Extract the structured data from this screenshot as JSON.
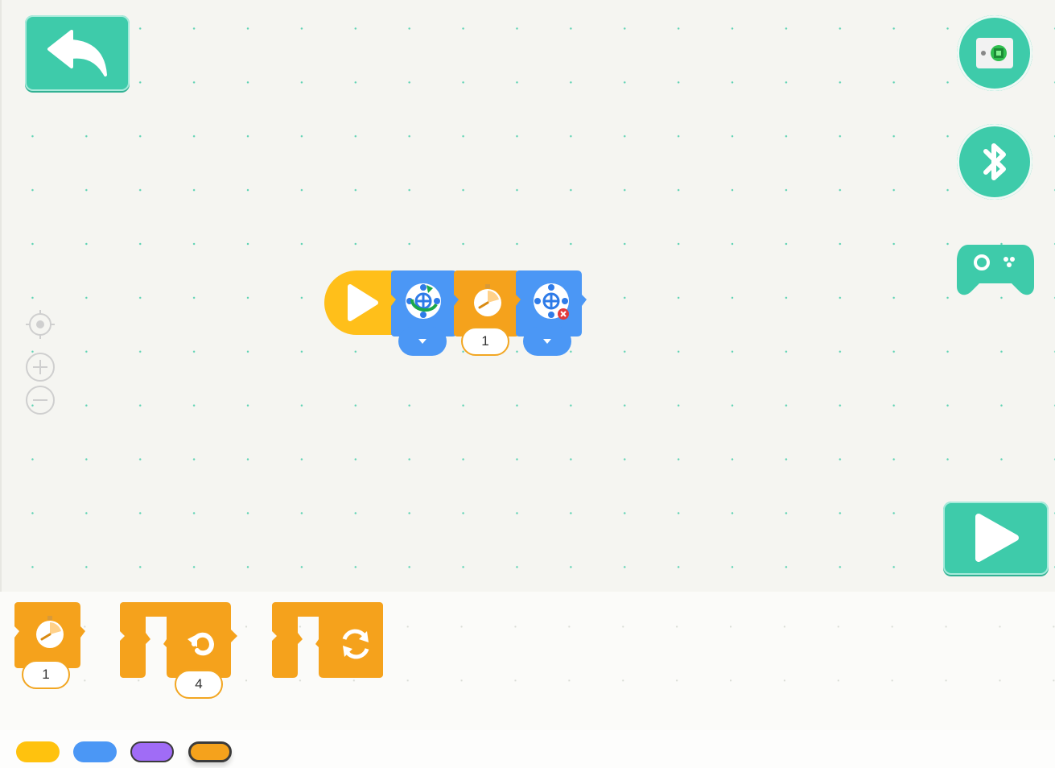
{
  "toolbar": {
    "back_icon": "undo-arrow-icon",
    "device_icon": "robot-device-icon",
    "bluetooth_icon": "bluetooth-icon",
    "gamepad_icon": "gamepad-icon",
    "run_icon": "play-icon"
  },
  "zoom": {
    "recenter_icon": "target-icon",
    "zoom_in_icon": "plus-circle-icon",
    "zoom_out_icon": "minus-circle-icon"
  },
  "script": {
    "start_block": "play-icon",
    "blocks": [
      {
        "type": "motion",
        "icon": "rotate-move-icon",
        "param": "dropdown"
      },
      {
        "type": "control",
        "icon": "stopwatch-icon",
        "value": "1"
      },
      {
        "type": "motion",
        "icon": "move-cross-remove-icon",
        "param": "dropdown"
      }
    ]
  },
  "palette": {
    "wait_block": {
      "icon": "stopwatch-icon",
      "value": "1"
    },
    "repeat_block": {
      "icon": "repeat-arrow-icon",
      "value": "4"
    },
    "forever_block": {
      "icon": "loop-arrows-icon"
    }
  },
  "categories": [
    {
      "name": "events",
      "color": "#ffc20e"
    },
    {
      "name": "motion",
      "color": "#4b97f5"
    },
    {
      "name": "looks",
      "color": "#a06cf6"
    },
    {
      "name": "control",
      "color": "#f5a21c",
      "selected": true
    }
  ],
  "colors": {
    "accent": "#3ecbaa",
    "events": "#ffc20e",
    "motion": "#4b97f5",
    "control": "#f5a21c"
  }
}
